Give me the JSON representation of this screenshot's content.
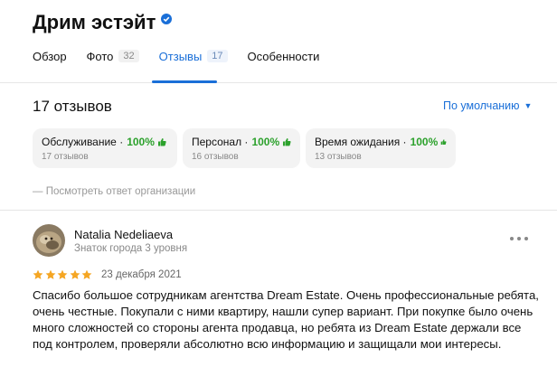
{
  "org": {
    "title": "Дрим эстэйт",
    "verified_icon": "verified-badge-icon",
    "accent_color": "#1a6fd8"
  },
  "tabs": [
    {
      "label": "Обзор",
      "count": null,
      "active": false
    },
    {
      "label": "Фото",
      "count": "32",
      "active": false
    },
    {
      "label": "Отзывы",
      "count": "17",
      "active": true
    },
    {
      "label": "Особенности",
      "count": null,
      "active": false
    }
  ],
  "reviews": {
    "count_label": "17 отзывов",
    "sort_label": "По умолчанию",
    "org_reply_label": "— Посмотреть ответ организации"
  },
  "aspects": [
    {
      "name": "Обслуживание",
      "percent": "100%",
      "reviews": "17 отзывов"
    },
    {
      "name": "Персонал",
      "percent": "100%",
      "reviews": "16 отзывов"
    },
    {
      "name": "Время ожидания",
      "percent": "100%",
      "reviews": "13 отзывов"
    }
  ],
  "review": {
    "author": "Natalia Nedeliaeva",
    "level": "Знаток города 3 уровня",
    "rating": 5,
    "date": "23 декабря 2021",
    "text": "Спасибо большое сотрудникам агентства Dream Estate. Очень профессиональные ребята, очень честные. Покупали с ними квартиру, нашли супер вариант. При покупке было очень много сложностей со стороны агента продавца, но ребята из Dream Estate держали все под контролем, проверяли абсолютно всю информацию и защищали мои интересы."
  },
  "colors": {
    "star": "#f5a623",
    "positive": "#2ca12c",
    "aspect_bg": "#f3f3f3"
  }
}
